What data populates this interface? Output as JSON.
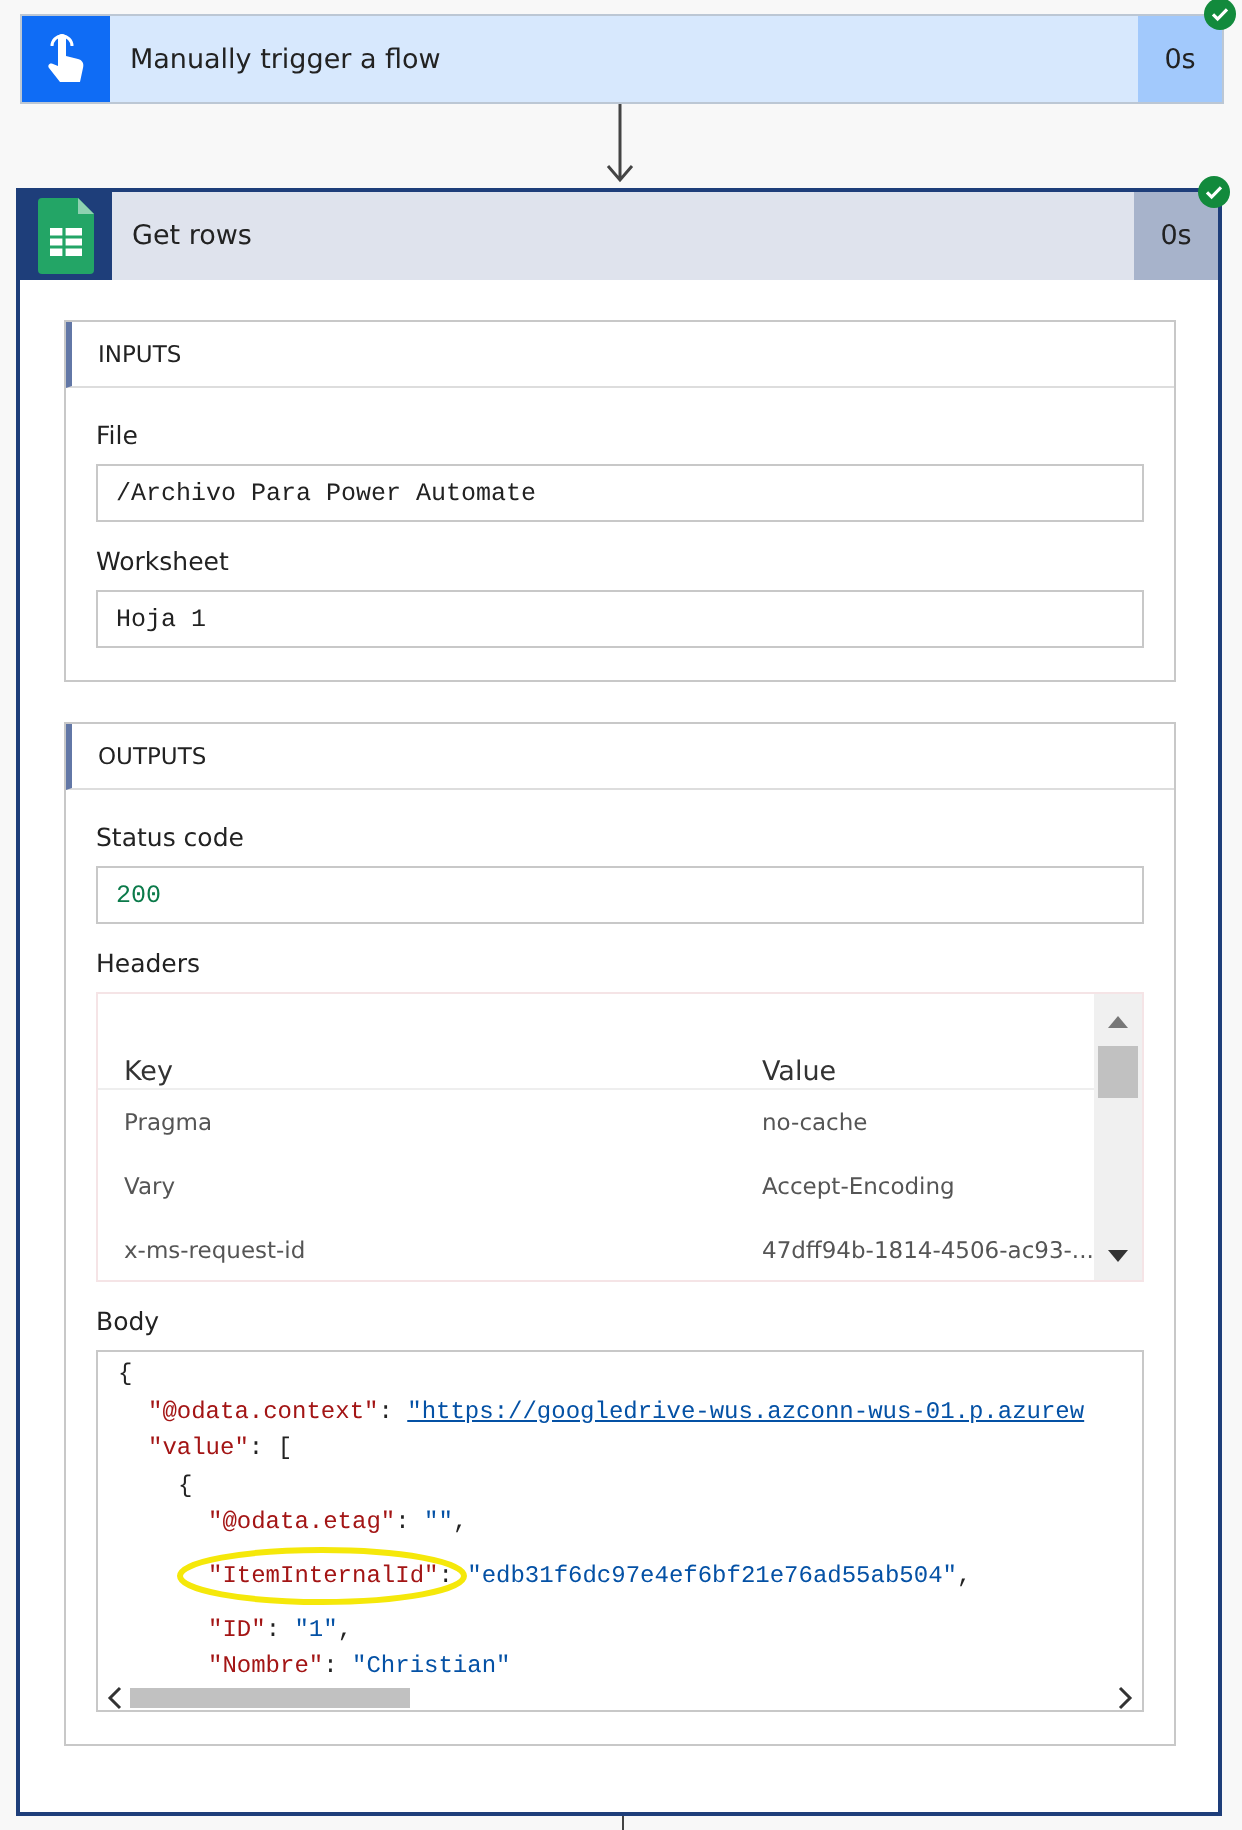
{
  "trigger": {
    "title": "Manually trigger a flow",
    "duration": "0s",
    "succeeded": true
  },
  "action": {
    "title": "Get rows",
    "duration": "0s",
    "succeeded": true,
    "inputs": {
      "heading": "INPUTS",
      "fields": [
        {
          "label": "File",
          "value": "/Archivo Para Power Automate"
        },
        {
          "label": "Worksheet",
          "value": "Hoja 1"
        }
      ]
    },
    "outputs": {
      "heading": "OUTPUTS",
      "status_code": {
        "label": "Status code",
        "value": "200"
      },
      "headers": {
        "label": "Headers",
        "columns": [
          "Key",
          "Value"
        ],
        "rows": [
          {
            "key": "Pragma",
            "value": "no-cache"
          },
          {
            "key": "Vary",
            "value": "Accept-Encoding"
          },
          {
            "key": "x-ms-request-id",
            "value": "47dff94b-1814-4506-ac93-..."
          }
        ]
      },
      "body": {
        "label": "Body",
        "lines": [
          {
            "highlighted": false,
            "tokens": [
              {
                "kind": "punct",
                "text": "{"
              }
            ]
          },
          {
            "highlighted": false,
            "tokens": [
              {
                "kind": "key",
                "text": "\"@odata.context\""
              },
              {
                "kind": "punct",
                "text": ": "
              },
              {
                "kind": "link",
                "text": "\"https://googledrive-wus.azconn-wus-01.p.azurew"
              }
            ]
          },
          {
            "highlighted": false,
            "tokens": [
              {
                "kind": "key",
                "text": "\"value\""
              },
              {
                "kind": "punct",
                "text": ": ["
              }
            ]
          },
          {
            "highlighted": false,
            "tokens": [
              {
                "kind": "punct",
                "text": "{"
              }
            ]
          },
          {
            "highlighted": false,
            "tokens": [
              {
                "kind": "key",
                "text": "\"@odata.etag\""
              },
              {
                "kind": "punct",
                "text": ": "
              },
              {
                "kind": "string",
                "text": "\"\""
              },
              {
                "kind": "punct",
                "text": ","
              }
            ]
          },
          {
            "highlighted": true,
            "tokens": [
              {
                "kind": "key",
                "text": "\"ItemInternalId\""
              },
              {
                "kind": "punct",
                "text": ": "
              },
              {
                "kind": "string",
                "text": "\"edb31f6dc97e4ef6bf21e76ad55ab504\""
              },
              {
                "kind": "punct",
                "text": ","
              }
            ]
          },
          {
            "highlighted": false,
            "tokens": [
              {
                "kind": "key",
                "text": "\"ID\""
              },
              {
                "kind": "punct",
                "text": ": "
              },
              {
                "kind": "string",
                "text": "\"1\""
              },
              {
                "kind": "punct",
                "text": ","
              }
            ]
          },
          {
            "highlighted": false,
            "tokens": [
              {
                "kind": "key",
                "text": "\"Nombre\""
              },
              {
                "kind": "punct",
                "text": ": "
              },
              {
                "kind": "string",
                "text": "\"Christian\""
              }
            ]
          }
        ]
      }
    }
  }
}
